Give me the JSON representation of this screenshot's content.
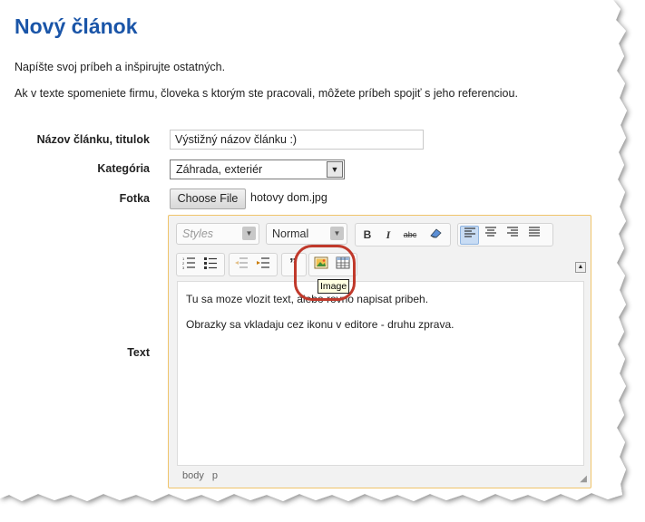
{
  "page": {
    "title": "Nový článok",
    "intro1": "Napíšte svoj príbeh a inšpirujte ostatných.",
    "intro2": "Ak v texte spomeniete firmu, človeka s ktorým ste pracovali, môžete príbeh spojiť s jeho referenciou."
  },
  "form": {
    "title_label": "Názov článku, titulok",
    "title_value": "Výstižný názov článku :)",
    "category_label": "Kategória",
    "category_value": "Záhrada, exteriér",
    "photo_label": "Fotka",
    "photo_button": "Choose File",
    "photo_file": "hotovy dom.jpg",
    "text_label": "Text"
  },
  "editor": {
    "styles_placeholder": "Styles",
    "format_value": "Normal",
    "bold": "B",
    "italic": "I",
    "strike": "abc",
    "blockquote": "”",
    "tooltip": "Image",
    "paragraph1": "Tu sa moze vlozit text, alebo rovno napisat pribeh.",
    "paragraph2": "Obrazky sa vkladaju cez ikonu v editore - druhu zprava.",
    "status_path": [
      "body",
      "p"
    ]
  },
  "colors": {
    "title": "#1a55a8",
    "highlight": "#c0392b",
    "editor_border": "#f0c46a"
  }
}
